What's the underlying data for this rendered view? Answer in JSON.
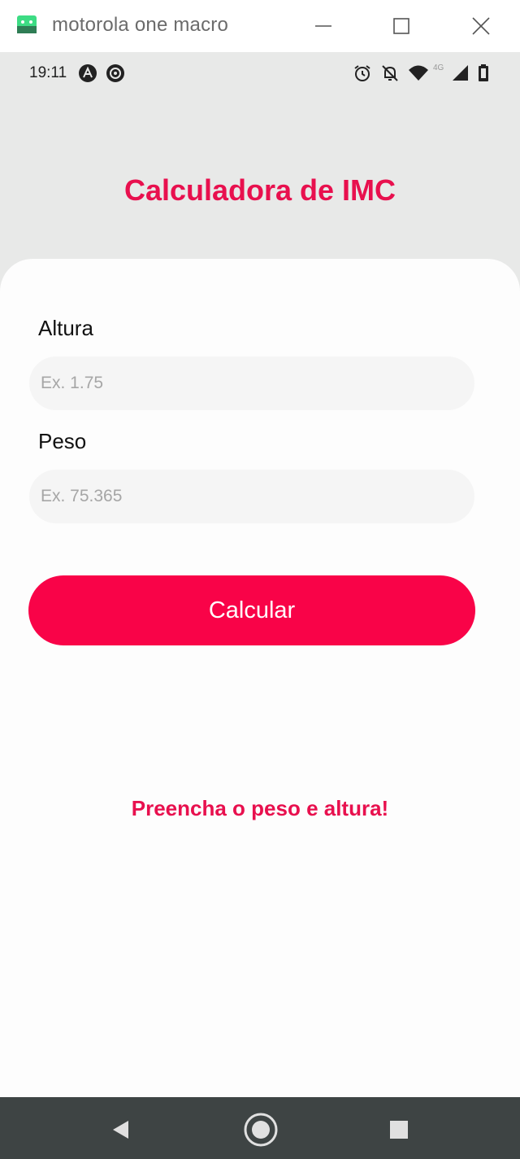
{
  "window": {
    "title": "motorola one macro",
    "icons": [
      "android-app-icon",
      "minimize-icon",
      "maximize-icon",
      "close-icon"
    ]
  },
  "status_bar": {
    "time": "19:11",
    "network_label": "4G",
    "icons": [
      "notification-a-icon",
      "notification-sync-icon",
      "alarm-icon",
      "silent-icon",
      "wifi-icon",
      "signal-icon",
      "battery-icon"
    ]
  },
  "app": {
    "title": "Calculadora de IMC",
    "height_label": "Altura",
    "height_placeholder": "Ex. 1.75",
    "height_value": "",
    "weight_label": "Peso",
    "weight_placeholder": "Ex. 75.365",
    "weight_value": "",
    "button_label": "Calcular",
    "message": "Preencha o peso e altura!"
  },
  "nav_bar": {
    "icons": [
      "back-icon",
      "home-icon",
      "recents-icon"
    ]
  },
  "colors": {
    "accent": "#e8104e",
    "button": "#f90348",
    "background": "#e8e9e8",
    "card": "#fdfdfd",
    "navbar": "#3e4444"
  }
}
